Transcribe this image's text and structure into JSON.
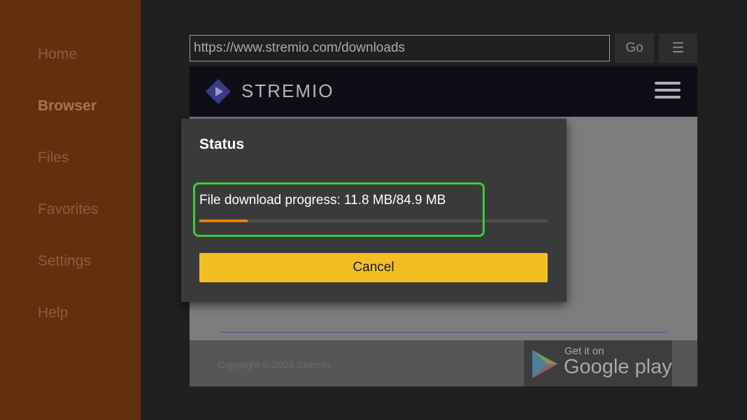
{
  "sidebar": {
    "items": [
      {
        "label": "Home"
      },
      {
        "label": "Browser"
      },
      {
        "label": "Files"
      },
      {
        "label": "Favorites"
      },
      {
        "label": "Settings"
      },
      {
        "label": "Help"
      }
    ],
    "active": "Browser"
  },
  "toolbar": {
    "url": "https://www.stremio.com/downloads",
    "go_label": "Go",
    "menu_label": "☰"
  },
  "webpage": {
    "logo_text": "STREMIO",
    "copyright": "Copyright © 2024  Stremio",
    "gplay_small": "Get it on",
    "gplay_big": "Google play"
  },
  "dialog": {
    "title": "Status",
    "progress_text": "File download progress: 11.8 MB/84.9 MB",
    "downloaded_mb": 11.8,
    "total_mb": 84.9,
    "cancel_label": "Cancel"
  },
  "colors": {
    "sidebar_bg": "#63300f",
    "accent_progress": "#f57c00",
    "cancel_button": "#f3be23",
    "highlight": "#3ecb3a"
  }
}
